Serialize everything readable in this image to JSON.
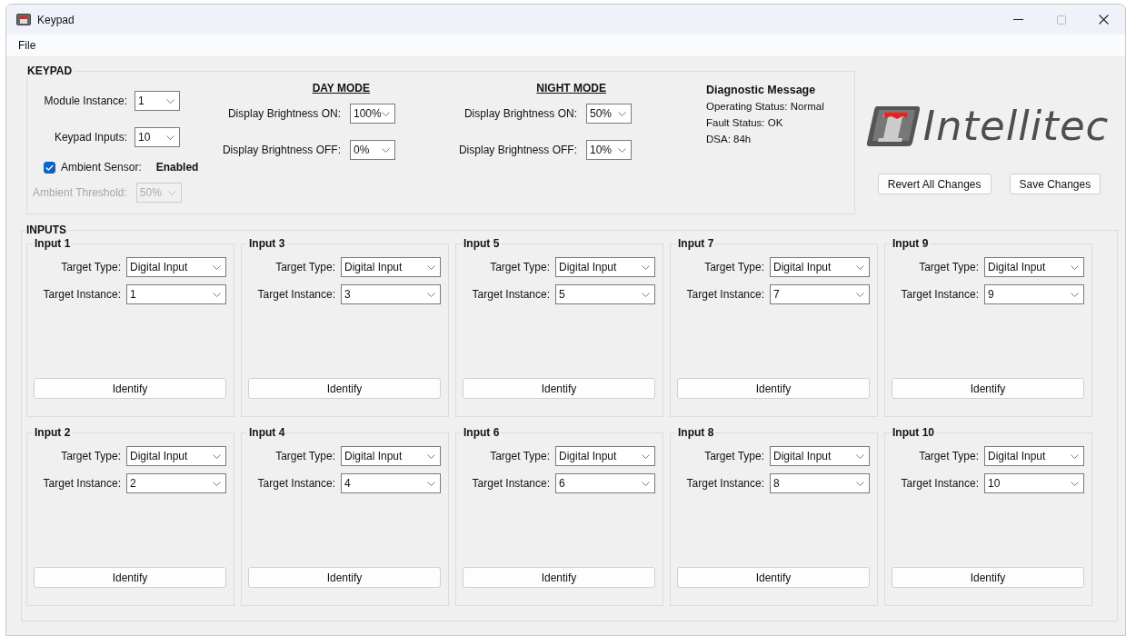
{
  "window": {
    "title": "Keypad"
  },
  "menu": [
    "File"
  ],
  "keypad": {
    "title": "KEYPAD",
    "fields": [
      {
        "label": "Module Instance:",
        "value": "1"
      },
      {
        "label": "Keypad Inputs:",
        "value": "10"
      }
    ],
    "ambient_sensor": {
      "label": "Ambient Sensor:",
      "checked": true,
      "status": "Enabled"
    },
    "ambient_threshold": {
      "label": "Ambient Threshold:",
      "value": "50%",
      "disabled": true
    },
    "modes": [
      {
        "title": "DAY MODE",
        "fields": [
          {
            "label": "Display Brightness ON:",
            "value": "100%"
          },
          {
            "label": "Display Brightness OFF:",
            "value": "0%"
          }
        ]
      },
      {
        "title": "NIGHT MODE",
        "fields": [
          {
            "label": "Display Brightness ON:",
            "value": "50%"
          },
          {
            "label": "Display Brightness OFF:",
            "value": "10%"
          }
        ]
      }
    ],
    "diagnostic": {
      "title": "Diagnostic Message",
      "lines": [
        "Operating Status: Normal",
        "Fault Status: OK",
        "DSA: 84h"
      ]
    }
  },
  "logo": {
    "text": "Intellitec"
  },
  "buttons": [
    "Revert All Changes",
    "Save Changes"
  ],
  "inputs": {
    "title": "INPUTS",
    "groups": [
      {
        "title": "Input 1",
        "type_label": "Target Type:",
        "type": "Digital Input",
        "instance_label": "Target Instance:",
        "instance": "1",
        "button": "Identify"
      },
      {
        "title": "Input 3",
        "type_label": "Target Type:",
        "type": "Digital Input",
        "instance_label": "Target Instance:",
        "instance": "3",
        "button": "Identify"
      },
      {
        "title": "Input 5",
        "type_label": "Target Type:",
        "type": "Digital Input",
        "instance_label": "Target Instance:",
        "instance": "5",
        "button": "Identify"
      },
      {
        "title": "Input 7",
        "type_label": "Target Type:",
        "type": "Digital Input",
        "instance_label": "Target Instance:",
        "instance": "7",
        "button": "Identify"
      },
      {
        "title": "Input 9",
        "type_label": "Target Type:",
        "type": "Digital Input",
        "instance_label": "Target Instance:",
        "instance": "9",
        "button": "Identify"
      },
      {
        "title": "Input 2",
        "type_label": "Target Type:",
        "type": "Digital Input",
        "instance_label": "Target Instance:",
        "instance": "2",
        "button": "Identify"
      },
      {
        "title": "Input 4",
        "type_label": "Target Type:",
        "type": "Digital Input",
        "instance_label": "Target Instance:",
        "instance": "4",
        "button": "Identify"
      },
      {
        "title": "Input 6",
        "type_label": "Target Type:",
        "type": "Digital Input",
        "instance_label": "Target Instance:",
        "instance": "6",
        "button": "Identify"
      },
      {
        "title": "Input 8",
        "type_label": "Target Type:",
        "type": "Digital Input",
        "instance_label": "Target Instance:",
        "instance": "8",
        "button": "Identify"
      },
      {
        "title": "Input 10",
        "type_label": "Target Type:",
        "type": "Digital Input",
        "instance_label": "Target Instance:",
        "instance": "10",
        "button": "Identify"
      }
    ]
  }
}
